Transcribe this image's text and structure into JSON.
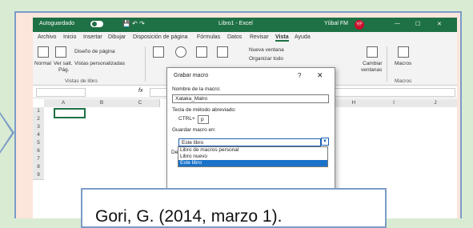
{
  "titlebar": {
    "autosave_label": "Autoguardado",
    "window_title": "Libro1 - Excel",
    "user_name": "Yûbal FM",
    "user_initials": "YF",
    "minimize": "—",
    "maximize": "☐",
    "close": "✕"
  },
  "menu": {
    "items": [
      "Archivo",
      "Inicio",
      "Insertar",
      "Dibujar",
      "Disposición de página",
      "Fórmulas",
      "Datos",
      "Revisar",
      "Vista",
      "Ayuda"
    ]
  },
  "ribbon": {
    "normal": "Normal",
    "ver_salt": "Ver salt.",
    "pag": "Pág.",
    "diseno": "Diseño de página",
    "vistas_personalizadas": "Vistas personalizadas",
    "group_vistas": "Vistas de libro",
    "nueva_ventana": "Nueva ventana",
    "organizar": "Organizar todo",
    "cambiar": "Cambiar",
    "ventanas": "ventanas",
    "macros": "Macros",
    "group_macros": "Macros"
  },
  "formula_bar": {
    "fx": "fx"
  },
  "grid": {
    "columns": [
      "A",
      "B",
      "C",
      "H",
      "I",
      "J"
    ],
    "rows": [
      "1",
      "2",
      "3",
      "4",
      "5",
      "6",
      "7",
      "8",
      "9"
    ]
  },
  "dialog": {
    "title": "Grabar macro",
    "help": "?",
    "close": "✕",
    "name_label": "Nombre de la macro:",
    "name_value": "Xataka_Malro",
    "shortcut_label": "Tecla de método abreviado:",
    "ctrl_label": "CTRL+",
    "shortcut_value": "p",
    "store_label": "Guardar macro en:",
    "store_value": "Este libro",
    "store_options": [
      "Libro de macros personal",
      "Libro nuevo",
      "Este libro"
    ],
    "desc_label": "Des"
  },
  "citation": {
    "text": "Gori, G. (2014, marzo 1)."
  }
}
